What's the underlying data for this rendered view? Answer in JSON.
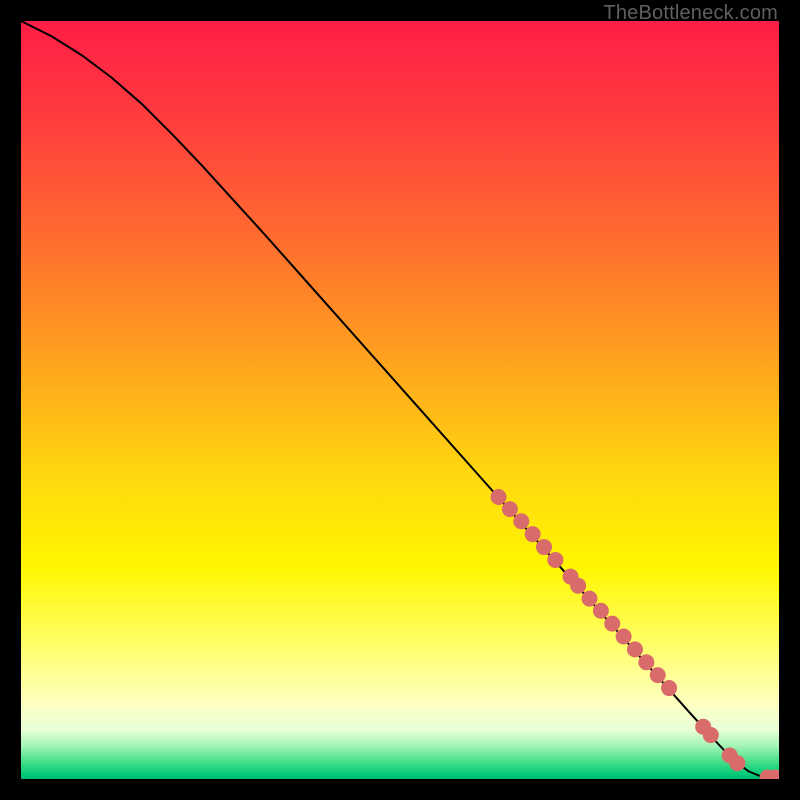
{
  "watermark": "TheBottleneck.com",
  "chart_data": {
    "type": "line",
    "title": "",
    "xlabel": "",
    "ylabel": "",
    "xlim": [
      0,
      100
    ],
    "ylim": [
      0,
      100
    ],
    "grid": false,
    "legend": false,
    "series": [
      {
        "name": "curve",
        "type": "line",
        "color": "#000000",
        "x": [
          0,
          4,
          8,
          12,
          16,
          20,
          24,
          28,
          32,
          36,
          40,
          44,
          48,
          52,
          56,
          60,
          64,
          68,
          72,
          76,
          80,
          84,
          88,
          90,
          92,
          94,
          96,
          98,
          100
        ],
        "y": [
          100,
          98,
          95.5,
          92.5,
          89,
          85,
          80.8,
          76.4,
          72,
          67.5,
          63,
          58.5,
          54,
          49.5,
          45,
          40.5,
          36,
          31.5,
          27,
          22.5,
          18,
          13.5,
          9,
          6.8,
          4.6,
          2.5,
          1.0,
          0.2,
          0.2
        ]
      },
      {
        "name": "marker-band",
        "type": "scatter",
        "color": "#d96b6b",
        "x": [
          63,
          64.5,
          66,
          67.5,
          69,
          70.5,
          72.5,
          73.5,
          75,
          76.5,
          78,
          79.5,
          81,
          82.5,
          84,
          85.5,
          90,
          91,
          93.5,
          94.5,
          98.5,
          99.5
        ],
        "y": [
          37.2,
          35.6,
          34.0,
          32.3,
          30.6,
          28.9,
          26.7,
          25.5,
          23.8,
          22.2,
          20.5,
          18.8,
          17.1,
          15.4,
          13.7,
          12.0,
          6.9,
          5.8,
          3.1,
          2.1,
          0.2,
          0.2
        ]
      }
    ],
    "background_gradient": {
      "stops": [
        {
          "offset": 0.0,
          "color": "#ff1e46"
        },
        {
          "offset": 0.12,
          "color": "#ff3a3f"
        },
        {
          "offset": 0.28,
          "color": "#ff6a30"
        },
        {
          "offset": 0.44,
          "color": "#ffa01f"
        },
        {
          "offset": 0.6,
          "color": "#ffd80f"
        },
        {
          "offset": 0.72,
          "color": "#fff600"
        },
        {
          "offset": 0.82,
          "color": "#ffff66"
        },
        {
          "offset": 0.9,
          "color": "#ffffc0"
        },
        {
          "offset": 0.935,
          "color": "#e8ffd8"
        },
        {
          "offset": 0.955,
          "color": "#a8f5b8"
        },
        {
          "offset": 0.975,
          "color": "#4fe28e"
        },
        {
          "offset": 0.995,
          "color": "#00c876"
        },
        {
          "offset": 1.0,
          "color": "#00b86e"
        }
      ]
    }
  }
}
